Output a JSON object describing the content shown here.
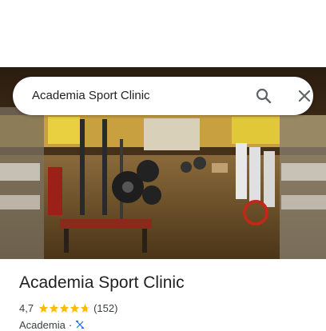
{
  "search": {
    "query": "Academia Sport Clinic"
  },
  "icons": {
    "search": "search-icon",
    "close": "close-icon",
    "category": "fitness-icon"
  },
  "place": {
    "name": "Academia Sport Clinic",
    "rating": "4,7",
    "rating_value": 4.7,
    "reviews": "(152)",
    "category": "Academia",
    "separator": "·"
  },
  "colors": {
    "star": "#fbbc04",
    "star_empty": "#dadce0",
    "icon_accent": "#1a73e8"
  }
}
